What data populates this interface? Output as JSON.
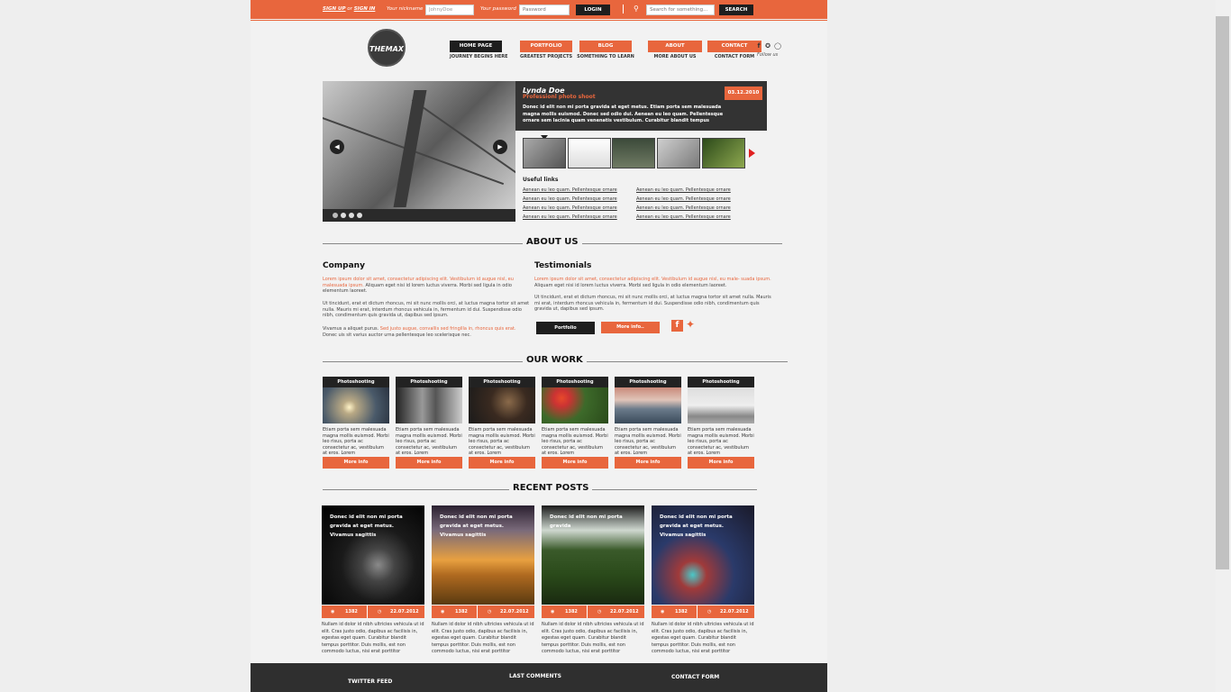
{
  "topbar": {
    "sign_up": "SIGN UP",
    "or": "or",
    "sign_in": "SIGN IN",
    "nickname_label": "Your nickname",
    "nickname_value": "JohnyDoe",
    "password_label": "Your password",
    "password_placeholder": "Password",
    "login": "LOGIN",
    "search_placeholder": "Search for something...",
    "search": "SEARCH"
  },
  "header": {
    "logo": "THEMAX",
    "nav": [
      {
        "label": "HOME PAGE",
        "sub": "JOURNEY BEGINS HERE"
      },
      {
        "label": "PORTFOLIO",
        "sub": "GREATEST PROJECTS"
      },
      {
        "label": "BLOG",
        "sub": "SOMETHING TO LEARN"
      },
      {
        "label": "ABOUT",
        "sub": "MORE ABOUT US"
      },
      {
        "label": "CONTACT",
        "sub": "CONTACT FORM"
      }
    ],
    "follow": "Follow us"
  },
  "slider": {
    "name": "Lynda Doe",
    "subtitle": "Professionl photo shoot",
    "date": "03.12.2010",
    "text": "Donec id elit non mi porta gravida at eget metus. Etiam porta sem malesuada magna mollis euismod. Donec sed odio dui. Aenean eu leo quam. Pellentesque ornare sem lacinia quam venenatis vestibulum. Curabitur blandit tempus",
    "links_title": "Useful links",
    "links_left": [
      "Aenean eu leo quam. Pellentesque ornare",
      "Aenean eu leo quam. Pellentesque ornare",
      "Aenean eu leo quam. Pellentesque ornare",
      "Aenean eu leo quam. Pellentesque ornare"
    ],
    "links_right": [
      "Aenean eu leo quam. Pellentesque ornare",
      "Aenean eu leo quam. Pellentesque ornare",
      "Aenean eu leo quam. Pellentesque ornare",
      "Aenean eu leo quam. Pellentesque ornare"
    ]
  },
  "about": {
    "title": "ABOUT US",
    "company_title": "Company",
    "company_p1_orange": "Lorem ipsum dolor sit amet, consectetur adipiscing elit. Vestibulum id augue nisl, eu malesuada ipsum.",
    "company_p1": " Aliquam eget nisi id lorem luctus viverra. Morbi sed ligula in odio elementum laoreet.",
    "company_p2": "Ut tincidunt, erat et dictum rhoncus, mi sit nunc mollis orci, at luctus magna tortor sit amet nulla. Mauris mi erat, interdum rhoncus vehicula in, fermentum id dui. Suspendisse odio nibh, condimentum quis gravida ut, dapibus sed ipsum.",
    "company_p3_a": "Vivamus a aliquet purus. ",
    "company_p3_orange": "Sed justo augue, convallis sed fringilla in, rhoncus quis erat.",
    "company_p3_b": " Donec uis sit varius auctor urna pellentesque leo scelerisque nec.",
    "testimonials_title": "Testimonials",
    "test_p1_orange": "Lorem ipsum dolor sit amet, consectetur adipiscing elit. Vestibulum id augue nisl, eu male- suada ipsum.",
    "test_p1": " Aliquam eget nisi id lorem luctus viverra. Morbi sed ligula in odio elementum laoreet.",
    "test_p2": "Ut tincidunt, erat et dictum rhoncus, mi sit nunc mollis orci, at luctus magna tortor sit amet nulla. Mauris mi erat, interdum rhoncus vehicula in, fermentum id dui. Suspendisse odio nibh, condimentum quis gravida ut, dapibus sed ipsum.",
    "portfolio_btn": "Portfolio",
    "more_btn": "More info.."
  },
  "work": {
    "title": "OUR WORK",
    "items": [
      {
        "title": "Photoshooting",
        "desc": "Etiam porta sem malesuada magna mollis euismod. Morbi leo risus, porta ac consectetur ac, vestibulum at eros. Lorem",
        "btn": "More info"
      },
      {
        "title": "Photoshooting",
        "desc": "Etiam porta sem malesuada magna mollis euismod. Morbi leo risus, porta ac consectetur ac, vestibulum at eros. Lorem",
        "btn": "More info"
      },
      {
        "title": "Photoshooting",
        "desc": "Etiam porta sem malesuada magna mollis euismod. Morbi leo risus, porta ac consectetur ac, vestibulum at eros. Lorem",
        "btn": "More info"
      },
      {
        "title": "Photoshooting",
        "desc": "Etiam porta sem malesuada magna mollis euismod. Morbi leo risus, porta ac consectetur ac, vestibulum at eros. Lorem",
        "btn": "More info"
      },
      {
        "title": "Photoshooting",
        "desc": "Etiam porta sem malesuada magna mollis euismod. Morbi leo risus, porta ac consectetur ac, vestibulum at eros. Lorem",
        "btn": "More info"
      },
      {
        "title": "Photoshooting",
        "desc": "Etiam porta sem malesuada magna mollis euismod. Morbi leo risus, porta ac consectetur ac, vestibulum at eros. Lorem",
        "btn": "More info"
      }
    ]
  },
  "posts": {
    "title": "RECENT POSTS",
    "items": [
      {
        "title": "Donec id elit non mi porta gravida at eget metus. Vivamus sagittis",
        "views": "1382",
        "date": "22.07.2012",
        "desc": "Nullam id dolor id nibh ultricies vehicula ut id elit. Cras justo odio, dapibus ac facilisis in, egestas eget quam. Curabitur blandit tempus porttitor. Duis mollis, est non commodo luctus, nisi erat porttitor"
      },
      {
        "title": "Donec id elit non mi porta gravida at eget metus. Vivamus sagittis",
        "views": "1382",
        "date": "22.07.2012",
        "desc": "Nullam id dolor id nibh ultricies vehicula ut id elit. Cras justo odio, dapibus ac facilisis in, egestas eget quam. Curabitur blandit tempus porttitor. Duis mollis, est non commodo luctus, nisi erat porttitor"
      },
      {
        "title": "Donec id elit non mi porta gravida",
        "views": "1382",
        "date": "22.07.2012",
        "desc": "Nullam id dolor id nibh ultricies vehicula ut id elit. Cras justo odio, dapibus ac facilisis in, egestas eget quam. Curabitur blandit tempus porttitor. Duis mollis, est non commodo luctus, nisi erat porttitor"
      },
      {
        "title": "Donec id elit non mi porta gravida at eget metus. Vivamus sagittis",
        "views": "1382",
        "date": "22.07.2012",
        "desc": "Nullam id dolor id nibh ultricies vehicula ut id elit. Cras justo odio, dapibus ac facilisis in, egestas eget quam. Curabitur blandit tempus porttitor. Duis mollis, est non commodo luctus, nisi erat porttitor"
      }
    ]
  },
  "footer": {
    "twitter": "TWITTER FEED",
    "comments": "LAST COMMENTS",
    "contact": "CONTACT FORM"
  },
  "colors": {
    "accent": "#e8663d",
    "dark": "#1e1e1e"
  }
}
